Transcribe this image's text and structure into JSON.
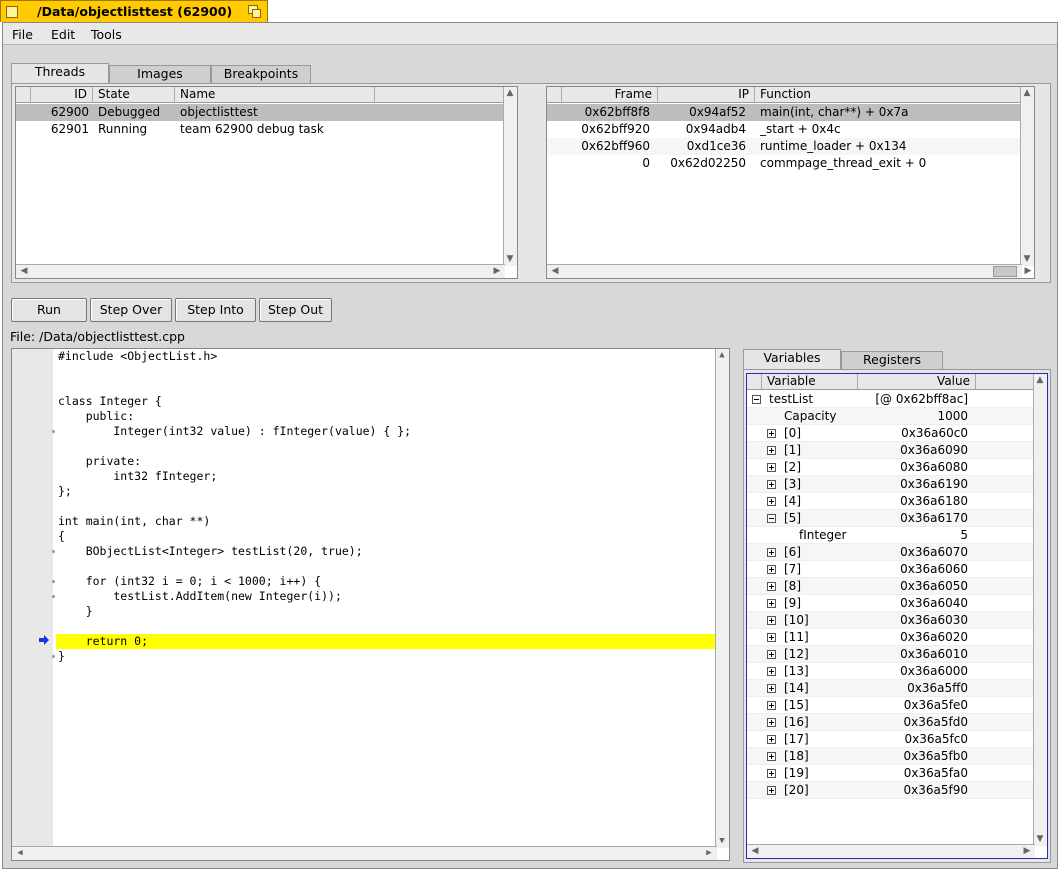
{
  "window": {
    "title": "/Data/objectlisttest (62900)"
  },
  "menu": [
    "File",
    "Edit",
    "Tools"
  ],
  "top_tabs": [
    "Threads",
    "Images",
    "Breakpoints"
  ],
  "threads": {
    "columns": [
      "ID",
      "State",
      "Name"
    ],
    "rows": [
      {
        "id": "62900",
        "state": "Debugged",
        "name": "objectlisttest"
      },
      {
        "id": "62901",
        "state": "Running",
        "name": "team 62900 debug task"
      }
    ]
  },
  "stack": {
    "columns": [
      "Frame",
      "IP",
      "Function"
    ],
    "rows": [
      {
        "frame": "0x62bff8f8",
        "ip": "0x94af52",
        "function": "main(int, char**) + 0x7a"
      },
      {
        "frame": "0x62bff920",
        "ip": "0x94adb4",
        "function": "_start + 0x4c"
      },
      {
        "frame": "0x62bff960",
        "ip": "0xd1ce36",
        "function": "runtime_loader + 0x134"
      },
      {
        "frame": "0",
        "ip": "0x62d02250",
        "function": "commpage_thread_exit + 0"
      }
    ]
  },
  "buttons": {
    "run": "Run",
    "step_over": "Step Over",
    "step_into": "Step Into",
    "step_out": "Step Out"
  },
  "file_label": "File: /Data/objectlisttest.cpp",
  "source_lines": [
    "#include <ObjectList.h>",
    "",
    "",
    "class Integer {",
    "    public:",
    "        Integer(int32 value) : fInteger(value) { };",
    "",
    "    private:",
    "        int32 fInteger;",
    "};",
    "",
    "int main(int, char **)",
    "{",
    "    BObjectList<Integer> testList(20, true);",
    "",
    "    for (int32 i = 0; i < 1000; i++) {",
    "        testList.AddItem(new Integer(i));",
    "    }",
    "",
    "    return 0;",
    "}"
  ],
  "right_tabs": [
    "Variables",
    "Registers"
  ],
  "variables": {
    "columns": [
      "Variable",
      "Value"
    ],
    "rows": [
      {
        "indent": 0,
        "exp": "minus",
        "name": "testList",
        "value": "[@ 0x62bff8ac]"
      },
      {
        "indent": 1,
        "exp": "none",
        "name": "Capacity",
        "value": "1000"
      },
      {
        "indent": 1,
        "exp": "plus",
        "name": "[0]",
        "value": "0x36a60c0"
      },
      {
        "indent": 1,
        "exp": "plus",
        "name": "[1]",
        "value": "0x36a6090"
      },
      {
        "indent": 1,
        "exp": "plus",
        "name": "[2]",
        "value": "0x36a6080"
      },
      {
        "indent": 1,
        "exp": "plus",
        "name": "[3]",
        "value": "0x36a6190"
      },
      {
        "indent": 1,
        "exp": "plus",
        "name": "[4]",
        "value": "0x36a6180"
      },
      {
        "indent": 1,
        "exp": "minus",
        "name": "[5]",
        "value": "0x36a6170"
      },
      {
        "indent": 2,
        "exp": "none",
        "name": "fInteger",
        "value": "5"
      },
      {
        "indent": 1,
        "exp": "plus",
        "name": "[6]",
        "value": "0x36a6070"
      },
      {
        "indent": 1,
        "exp": "plus",
        "name": "[7]",
        "value": "0x36a6060"
      },
      {
        "indent": 1,
        "exp": "plus",
        "name": "[8]",
        "value": "0x36a6050"
      },
      {
        "indent": 1,
        "exp": "plus",
        "name": "[9]",
        "value": "0x36a6040"
      },
      {
        "indent": 1,
        "exp": "plus",
        "name": "[10]",
        "value": "0x36a6030"
      },
      {
        "indent": 1,
        "exp": "plus",
        "name": "[11]",
        "value": "0x36a6020"
      },
      {
        "indent": 1,
        "exp": "plus",
        "name": "[12]",
        "value": "0x36a6010"
      },
      {
        "indent": 1,
        "exp": "plus",
        "name": "[13]",
        "value": "0x36a6000"
      },
      {
        "indent": 1,
        "exp": "plus",
        "name": "[14]",
        "value": "0x36a5ff0"
      },
      {
        "indent": 1,
        "exp": "plus",
        "name": "[15]",
        "value": "0x36a5fe0"
      },
      {
        "indent": 1,
        "exp": "plus",
        "name": "[16]",
        "value": "0x36a5fd0"
      },
      {
        "indent": 1,
        "exp": "plus",
        "name": "[17]",
        "value": "0x36a5fc0"
      },
      {
        "indent": 1,
        "exp": "plus",
        "name": "[18]",
        "value": "0x36a5fb0"
      },
      {
        "indent": 1,
        "exp": "plus",
        "name": "[19]",
        "value": "0x36a5fa0"
      },
      {
        "indent": 1,
        "exp": "plus",
        "name": "[20]",
        "value": "0x36a5f90"
      }
    ]
  },
  "colors": {
    "title_tab": "#ffcb00",
    "current_line": "#ffff00",
    "instruction_pointer": "#1a35e8"
  }
}
